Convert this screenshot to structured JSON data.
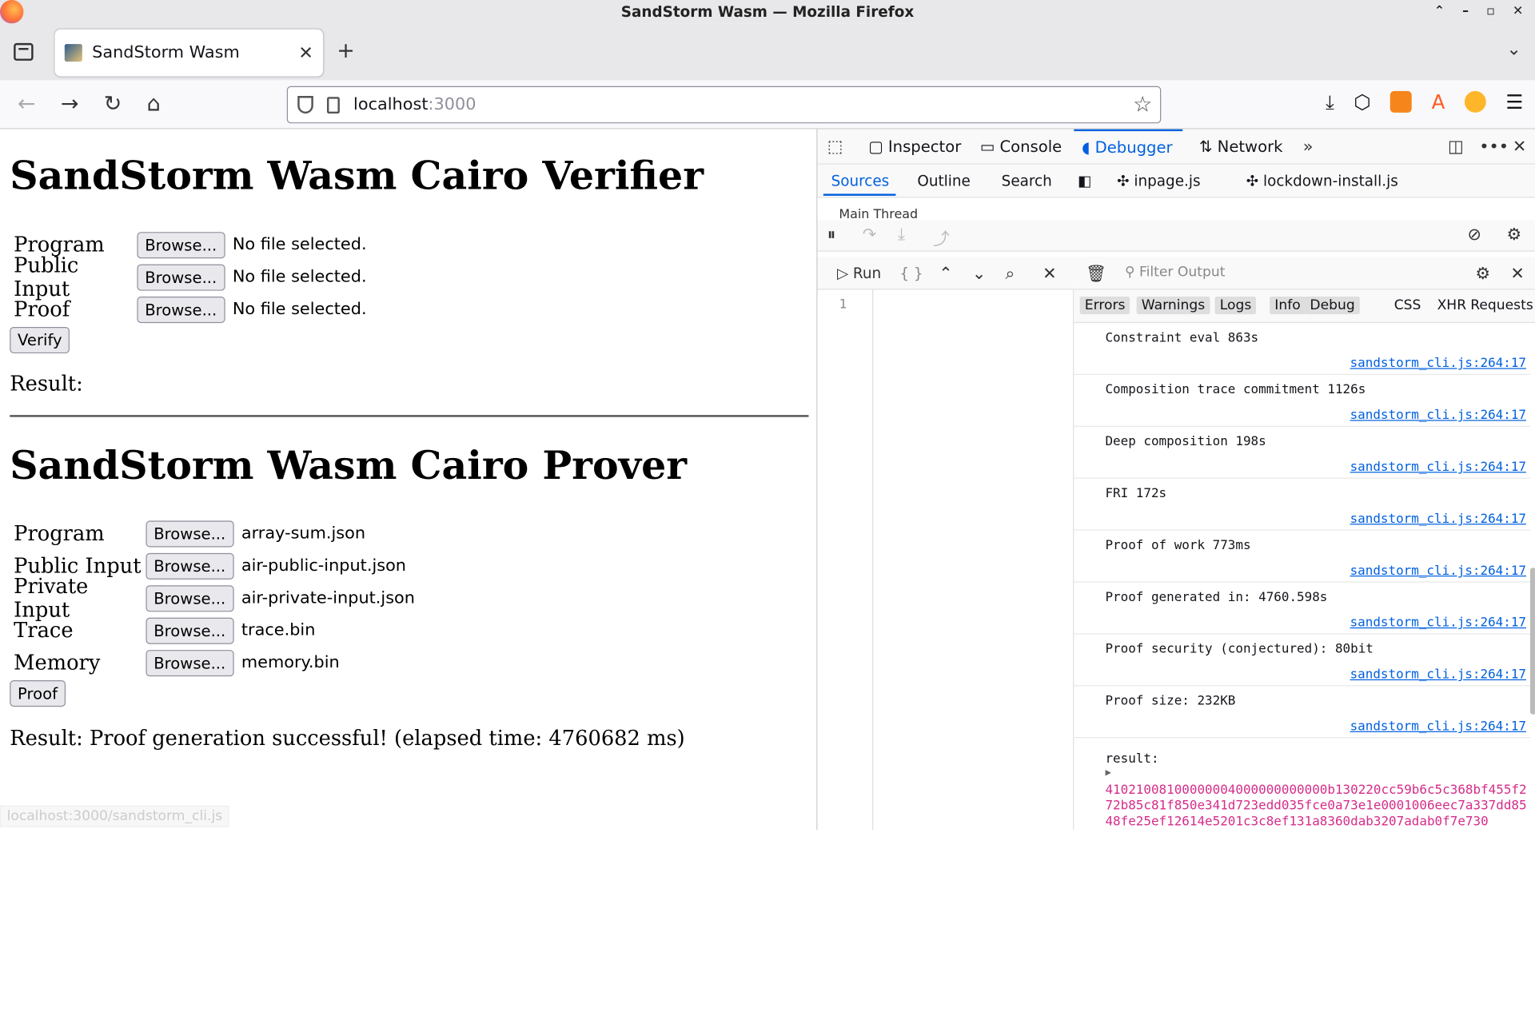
{
  "window": {
    "title": "SandStorm Wasm — Mozilla Firefox"
  },
  "tabs": [
    {
      "label": "SandStorm Wasm"
    }
  ],
  "url": {
    "host": "localhost",
    "port": ":3000"
  },
  "verifier": {
    "title": "SandStorm Wasm Cairo Verifier",
    "rows": [
      {
        "label": "Program",
        "button": "Browse...",
        "file": "No file selected."
      },
      {
        "label": "Public Input",
        "button": "Browse...",
        "file": "No file selected."
      },
      {
        "label": "Proof",
        "button": "Browse...",
        "file": "No file selected."
      }
    ],
    "action": "Verify",
    "result": "Result:"
  },
  "prover": {
    "title": "SandStorm Wasm Cairo Prover",
    "rows": [
      {
        "label": "Program",
        "button": "Browse...",
        "file": "array-sum.json"
      },
      {
        "label": "Public Input",
        "button": "Browse...",
        "file": "air-public-input.json"
      },
      {
        "label": "Private Input",
        "button": "Browse...",
        "file": "air-private-input.json"
      },
      {
        "label": "Trace",
        "button": "Browse...",
        "file": "trace.bin"
      },
      {
        "label": "Memory",
        "button": "Browse...",
        "file": "memory.bin"
      }
    ],
    "action": "Proof",
    "result": "Result: Proof generation successful! (elapsed time: 4760682 ms)"
  },
  "status_url": "localhost:3000/sandstorm_cli.js",
  "devtools": {
    "tabs": [
      "Inspector",
      "Console",
      "Debugger",
      "Network"
    ],
    "active_tab": "Debugger",
    "source_tabs": [
      "Sources",
      "Outline",
      "Search"
    ],
    "open_files": [
      "inpage.js",
      "lockdown-install.js"
    ],
    "tree_row": "Main Thread",
    "run_label": "Run",
    "braces_label": "{ }",
    "line_number": "1",
    "filter_placeholder": "Filter Output",
    "filters": [
      "Errors",
      "Warnings",
      "Logs",
      "Info",
      "Debug",
      "CSS",
      "XHR",
      "Requests"
    ],
    "logs": [
      {
        "msg": "Constraint eval 863s",
        "src": "sandstorm_cli.js:264:17"
      },
      {
        "msg": "Composition trace commitment 1126s",
        "src": "sandstorm_cli.js:264:17"
      },
      {
        "msg": "Deep composition 198s",
        "src": "sandstorm_cli.js:264:17"
      },
      {
        "msg": "FRI 172s",
        "src": "sandstorm_cli.js:264:17"
      },
      {
        "msg": "Proof of work 773ms",
        "src": "sandstorm_cli.js:264:17"
      },
      {
        "msg": "Proof generated in: 4760.598s",
        "src": "sandstorm_cli.js:264:17"
      },
      {
        "msg": "Proof security (conjectured): 80bit",
        "src": "sandstorm_cli.js:264:17"
      },
      {
        "msg": "Proof size: 232KB",
        "src": "sandstorm_cli.js:264:17"
      }
    ],
    "result_label": "result:",
    "result_hex": "41021008100000004000000000000b130220cc59b6c5c368bf455f272b85c81f850e341d723edd035fce0a73e1e0001006eec7a337dd8548fe25ef12614e5201c3c8ef131a8360dab3207adab0f7e730"
  }
}
